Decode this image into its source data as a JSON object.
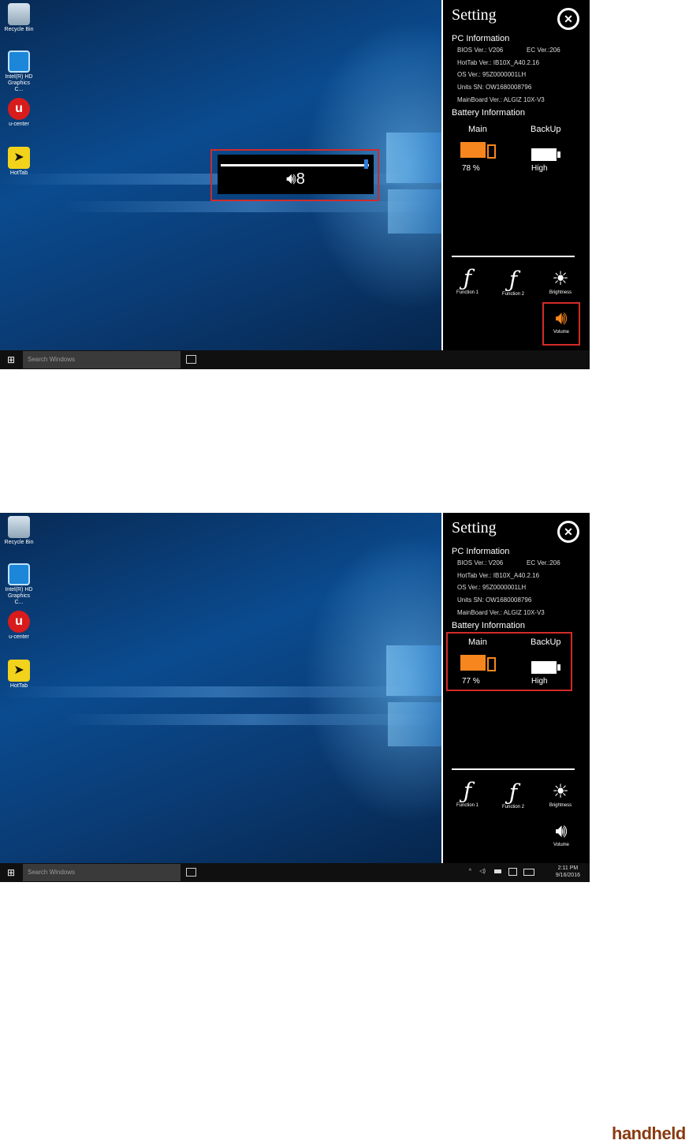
{
  "desktop_icons": [
    {
      "label": "Recycle Bin",
      "name": "recycle-bin"
    },
    {
      "label": "Intel(R) HD Graphics C...",
      "name": "intel-hd-graphics"
    },
    {
      "label": "u-center",
      "name": "u-center"
    },
    {
      "label": "HotTab",
      "name": "hottab"
    }
  ],
  "taskbar": {
    "search_placeholder": "Search Windows",
    "time": "2:11 PM",
    "date": "9/16/2016"
  },
  "panel": {
    "title": "Setting",
    "pc_info_header": "PC Information",
    "bios": "BIOS Ver.: V206",
    "ec": "EC Ver.:206",
    "hottab": "HotTab Ver.: IB10X_A40.2.16",
    "os": "OS Ver.: 95Z0000001LH",
    "sn": "Units SN: OW1680008796",
    "mainboard": "MainBoard Ver.: ALGIZ 10X-V3",
    "battery_header": "Battery Information",
    "main_label": "Main",
    "backup_label": "BackUp",
    "backup_value": "High",
    "function1": "Function 1",
    "function2": "Function 2",
    "brightness": "Brightness",
    "volume": "Volume"
  },
  "screen1": {
    "main_battery": "78 %",
    "volume_level": "8"
  },
  "screen2": {
    "main_battery": "77 %"
  },
  "colors": {
    "accent": "#f7861e",
    "highlight": "#d32a2a"
  },
  "brand": "handheld"
}
